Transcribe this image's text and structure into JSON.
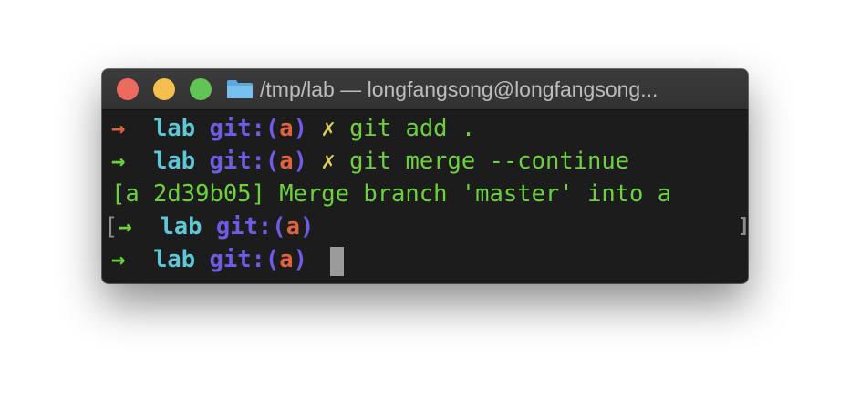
{
  "window": {
    "title": "/tmp/lab — longfangsong@longfangsong...",
    "folder_icon": "folder-icon"
  },
  "terminal": {
    "lines": [
      {
        "arrow": "→",
        "dir": "lab",
        "git_label": "git:(",
        "branch": "a",
        "git_close": ")",
        "dirty": "✗",
        "command": "git add ."
      },
      {
        "arrow": "→",
        "dir": "lab",
        "git_label": "git:(",
        "branch": "a",
        "git_close": ")",
        "dirty": "✗",
        "command": "git merge --continue"
      },
      {
        "output": "[a 2d39b05] Merge branch 'master' into a"
      },
      {
        "bracket_open": "[",
        "arrow": "→",
        "dir": "lab",
        "git_label": "git:(",
        "branch": "a",
        "git_close": ")",
        "bracket_close": "]"
      },
      {
        "arrow": "→",
        "dir": "lab",
        "git_label": "git:(",
        "branch": "a",
        "git_close": ")"
      }
    ]
  },
  "colors": {
    "arrow_failed": "#e0623f",
    "arrow_success": "#6dd13e",
    "directory": "#5fc8d8",
    "git_label": "#6c5ce6",
    "branch": "#e0623f",
    "dirty_marker": "#d9cf5a"
  }
}
